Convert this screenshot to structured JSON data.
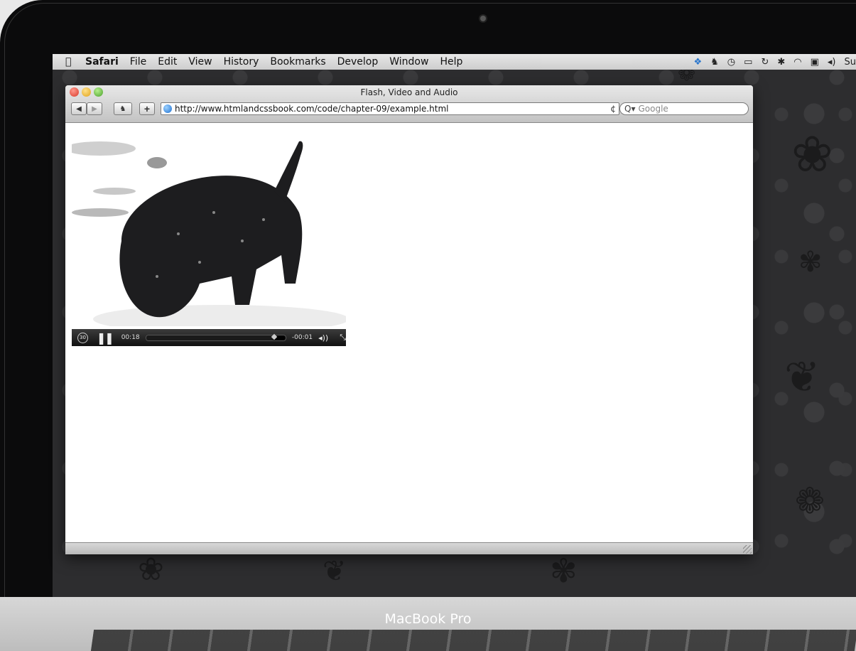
{
  "device": {
    "label": "MacBook Pro"
  },
  "menubar": {
    "app": "Safari",
    "items": [
      "File",
      "Edit",
      "View",
      "History",
      "Bookmarks",
      "Develop",
      "Window",
      "Help"
    ],
    "status_icons": [
      "dropbox-icon",
      "evernote-icon",
      "time-machine-icon",
      "display-icon",
      "sync-icon",
      "bluetooth-icon",
      "wifi-icon",
      "input-menu-icon",
      "volume-icon"
    ],
    "clock_partial": "Su"
  },
  "window": {
    "title": "Flash, Video and Audio",
    "url": "http://www.htmlandcssbook.com/code/chapter-09/example.html",
    "search_placeholder": "Google"
  },
  "video": {
    "elapsed": "00:18",
    "remaining": "-00:01",
    "progress": 0.92,
    "replay_label": "30"
  }
}
